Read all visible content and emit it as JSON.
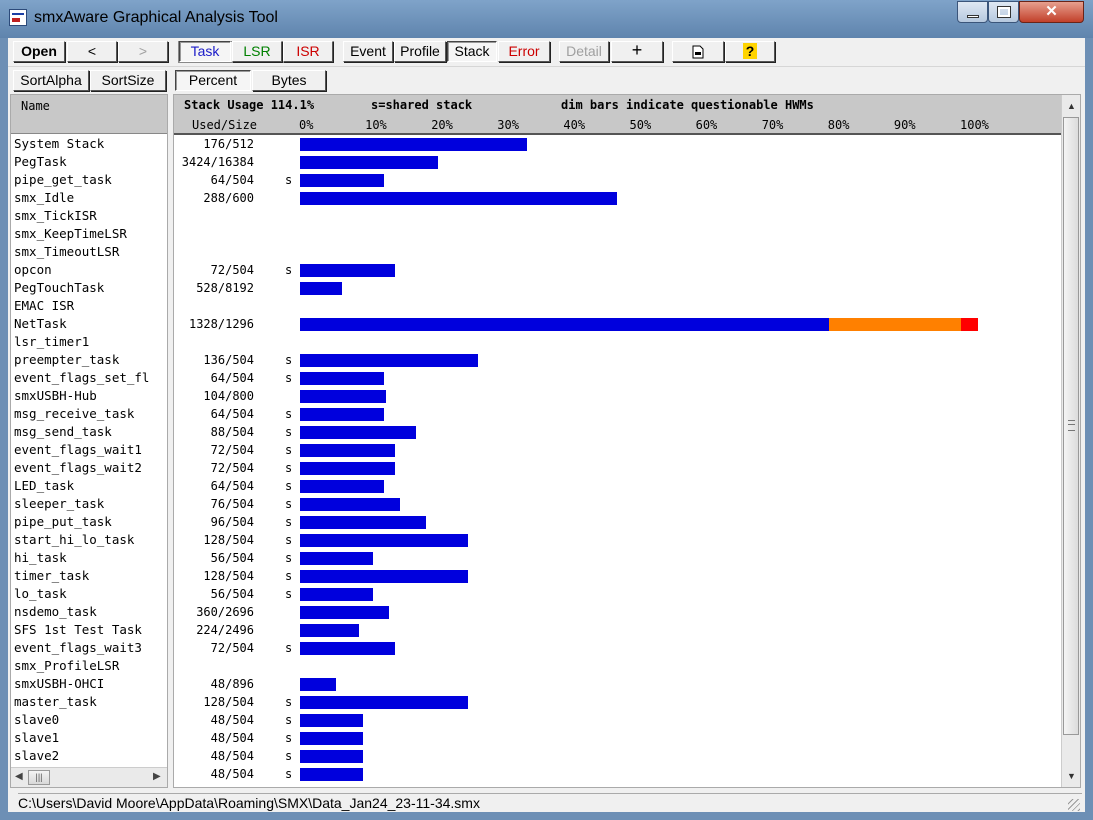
{
  "window": {
    "title": "smxAware Graphical Analysis Tool"
  },
  "toolbar": {
    "open": "Open",
    "back": "<",
    "forward": ">",
    "task": "Task",
    "lsr": "LSR",
    "isr": "ISR",
    "event": "Event",
    "profile": "Profile",
    "stack": "Stack",
    "error": "Error",
    "detail": "Detail",
    "zoom": "+",
    "colors": {
      "task": "#1a1ac8",
      "lsr": "#008000",
      "isr": "#cc0000",
      "error": "#cc0000"
    }
  },
  "toolbar2": {
    "sort_alpha": "SortAlpha",
    "sort_size": "SortSize",
    "percent": "Percent",
    "bytes": "Bytes"
  },
  "names_header": "Name",
  "chart_header": {
    "title": "Stack Usage 114.1%",
    "note1": "s=shared stack",
    "note2": "dim bars indicate questionable HWMs",
    "used_size": "Used/Size"
  },
  "chart_data": {
    "type": "bar",
    "orientation": "horizontal",
    "title": "Stack Usage 114.1%",
    "x_ticks": [
      "0%",
      "10%",
      "20%",
      "30%",
      "40%",
      "50%",
      "60%",
      "70%",
      "80%",
      "90%",
      "100%"
    ],
    "xlim": [
      0,
      100
    ],
    "colors": {
      "bar": "#0000dd",
      "over1": "#ff8000",
      "over2": "#ff0000"
    },
    "rows": [
      {
        "name": "System Stack",
        "used": "176/512",
        "shared": "",
        "pct": 34.4
      },
      {
        "name": "PegTask",
        "used": "3424/16384",
        "shared": "",
        "pct": 20.9
      },
      {
        "name": "pipe_get_task",
        "used": "64/504",
        "shared": "s",
        "pct": 12.7
      },
      {
        "name": "smx_Idle",
        "used": "288/600",
        "shared": "",
        "pct": 48.0
      },
      {
        "name": "smx_TickISR",
        "used": "",
        "shared": "",
        "pct": 0
      },
      {
        "name": "smx_KeepTimeLSR",
        "used": "",
        "shared": "",
        "pct": 0
      },
      {
        "name": "smx_TimeoutLSR",
        "used": "",
        "shared": "",
        "pct": 0
      },
      {
        "name": "opcon",
        "used": "72/504",
        "shared": "s",
        "pct": 14.3
      },
      {
        "name": "PegTouchTask",
        "used": "528/8192",
        "shared": "",
        "pct": 6.4
      },
      {
        "name": "EMAC ISR",
        "used": "",
        "shared": "",
        "pct": 0
      },
      {
        "name": "NetTask",
        "used": "1328/1296",
        "shared": "",
        "pct": 102.5
      },
      {
        "name": "lsr_timer1",
        "used": "",
        "shared": "",
        "pct": 0
      },
      {
        "name": "preempter_task",
        "used": "136/504",
        "shared": "s",
        "pct": 27.0
      },
      {
        "name": "event_flags_set_fl",
        "used": "64/504",
        "shared": "s",
        "pct": 12.7
      },
      {
        "name": "smxUSBH-Hub",
        "used": "104/800",
        "shared": "",
        "pct": 13.0
      },
      {
        "name": "msg_receive_task",
        "used": "64/504",
        "shared": "s",
        "pct": 12.7
      },
      {
        "name": "msg_send_task",
        "used": "88/504",
        "shared": "s",
        "pct": 17.5
      },
      {
        "name": "event_flags_wait1",
        "used": "72/504",
        "shared": "s",
        "pct": 14.3
      },
      {
        "name": "event_flags_wait2",
        "used": "72/504",
        "shared": "s",
        "pct": 14.3
      },
      {
        "name": "LED_task",
        "used": "64/504",
        "shared": "s",
        "pct": 12.7
      },
      {
        "name": "sleeper_task",
        "used": "76/504",
        "shared": "s",
        "pct": 15.1
      },
      {
        "name": "pipe_put_task",
        "used": "96/504",
        "shared": "s",
        "pct": 19.0
      },
      {
        "name": "start_hi_lo_task",
        "used": "128/504",
        "shared": "s",
        "pct": 25.4
      },
      {
        "name": "hi_task",
        "used": "56/504",
        "shared": "s",
        "pct": 11.1
      },
      {
        "name": "timer_task",
        "used": "128/504",
        "shared": "s",
        "pct": 25.4
      },
      {
        "name": "lo_task",
        "used": "56/504",
        "shared": "s",
        "pct": 11.1
      },
      {
        "name": "nsdemo_task",
        "used": "360/2696",
        "shared": "",
        "pct": 13.4
      },
      {
        "name": "SFS 1st Test Task",
        "used": "224/2496",
        "shared": "",
        "pct": 9.0
      },
      {
        "name": "event_flags_wait3",
        "used": "72/504",
        "shared": "s",
        "pct": 14.3
      },
      {
        "name": "smx_ProfileLSR",
        "used": "",
        "shared": "",
        "pct": 0
      },
      {
        "name": "smxUSBH-OHCI",
        "used": "48/896",
        "shared": "",
        "pct": 5.4
      },
      {
        "name": "master_task",
        "used": "128/504",
        "shared": "s",
        "pct": 25.4
      },
      {
        "name": "slave0",
        "used": "48/504",
        "shared": "s",
        "pct": 9.5
      },
      {
        "name": "slave1",
        "used": "48/504",
        "shared": "s",
        "pct": 9.5
      },
      {
        "name": "slave2",
        "used": "48/504",
        "shared": "s",
        "pct": 9.5
      },
      {
        "name": "",
        "used": "48/504",
        "shared": "s",
        "pct": 9.5
      }
    ]
  },
  "status": {
    "path": "C:\\Users\\David Moore\\AppData\\Roaming\\SMX\\Data_Jan24_23-11-34.smx"
  }
}
